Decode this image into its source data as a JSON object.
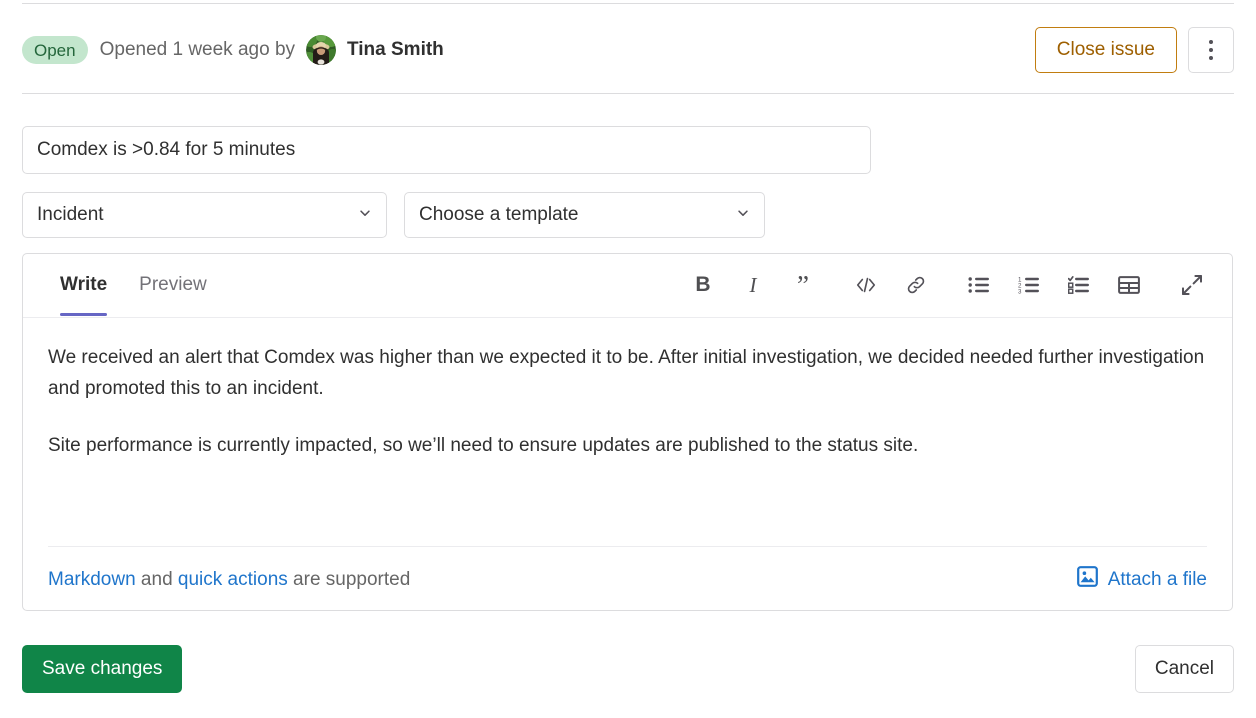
{
  "header": {
    "status_badge": "Open",
    "opened_text": "Opened 1 week ago by",
    "author": "Tina Smith",
    "close_button": "Close issue",
    "more_actions_icon": "kebab-menu-icon"
  },
  "form": {
    "title_value": "Comdex is >0.84 for 5 minutes",
    "title_placeholder": "Title",
    "type_select": "Incident",
    "template_select": "Choose a template"
  },
  "editor": {
    "tabs": [
      {
        "label": "Write",
        "active": true
      },
      {
        "label": "Preview",
        "active": false
      }
    ],
    "toolbar": [
      {
        "name": "bold-icon",
        "glyph": "B",
        "title": "Bold"
      },
      {
        "name": "italic-icon",
        "glyph": "I",
        "title": "Italic"
      },
      {
        "name": "quote-icon",
        "glyph": "”",
        "title": "Insert a quote"
      },
      {
        "name": "code-icon",
        "glyph": "",
        "title": "Insert code"
      },
      {
        "name": "link-icon",
        "glyph": "",
        "title": "Add a link"
      },
      {
        "name": "bullet-list-icon",
        "glyph": "",
        "title": "Add a bullet list"
      },
      {
        "name": "numbered-list-icon",
        "glyph": "",
        "title": "Add a numbered list"
      },
      {
        "name": "task-list-icon",
        "glyph": "",
        "title": "Add a checklist"
      },
      {
        "name": "table-icon",
        "glyph": "",
        "title": "Add a table"
      },
      {
        "name": "fullscreen-icon",
        "glyph": "",
        "title": "Go full screen"
      }
    ],
    "body_paragraphs": [
      "We received an alert that Comdex was higher than we expected it to be. After initial investigation, we decided needed further investigation and promoted this to an incident.",
      "Site performance is currently impacted, so we’ll need to ensure updates are published to the status site."
    ],
    "footer": {
      "markdown_link": "Markdown",
      "and_text": " and ",
      "quick_actions_link": "quick actions",
      "supported_text": " are supported",
      "attach_label": "Attach a file",
      "attach_icon": "image-attachment-icon"
    }
  },
  "actions": {
    "save_label": "Save changes",
    "cancel_label": "Cancel"
  },
  "colors": {
    "status_badge_bg": "#c3e6cd",
    "status_badge_text": "#24663b",
    "close_issue_border": "#c17d10",
    "close_issue_text": "#9e5f00",
    "active_tab_underline": "#6666c4",
    "link_blue": "#1f75cb",
    "save_green": "#108548",
    "border_gray": "#dcdcde"
  }
}
